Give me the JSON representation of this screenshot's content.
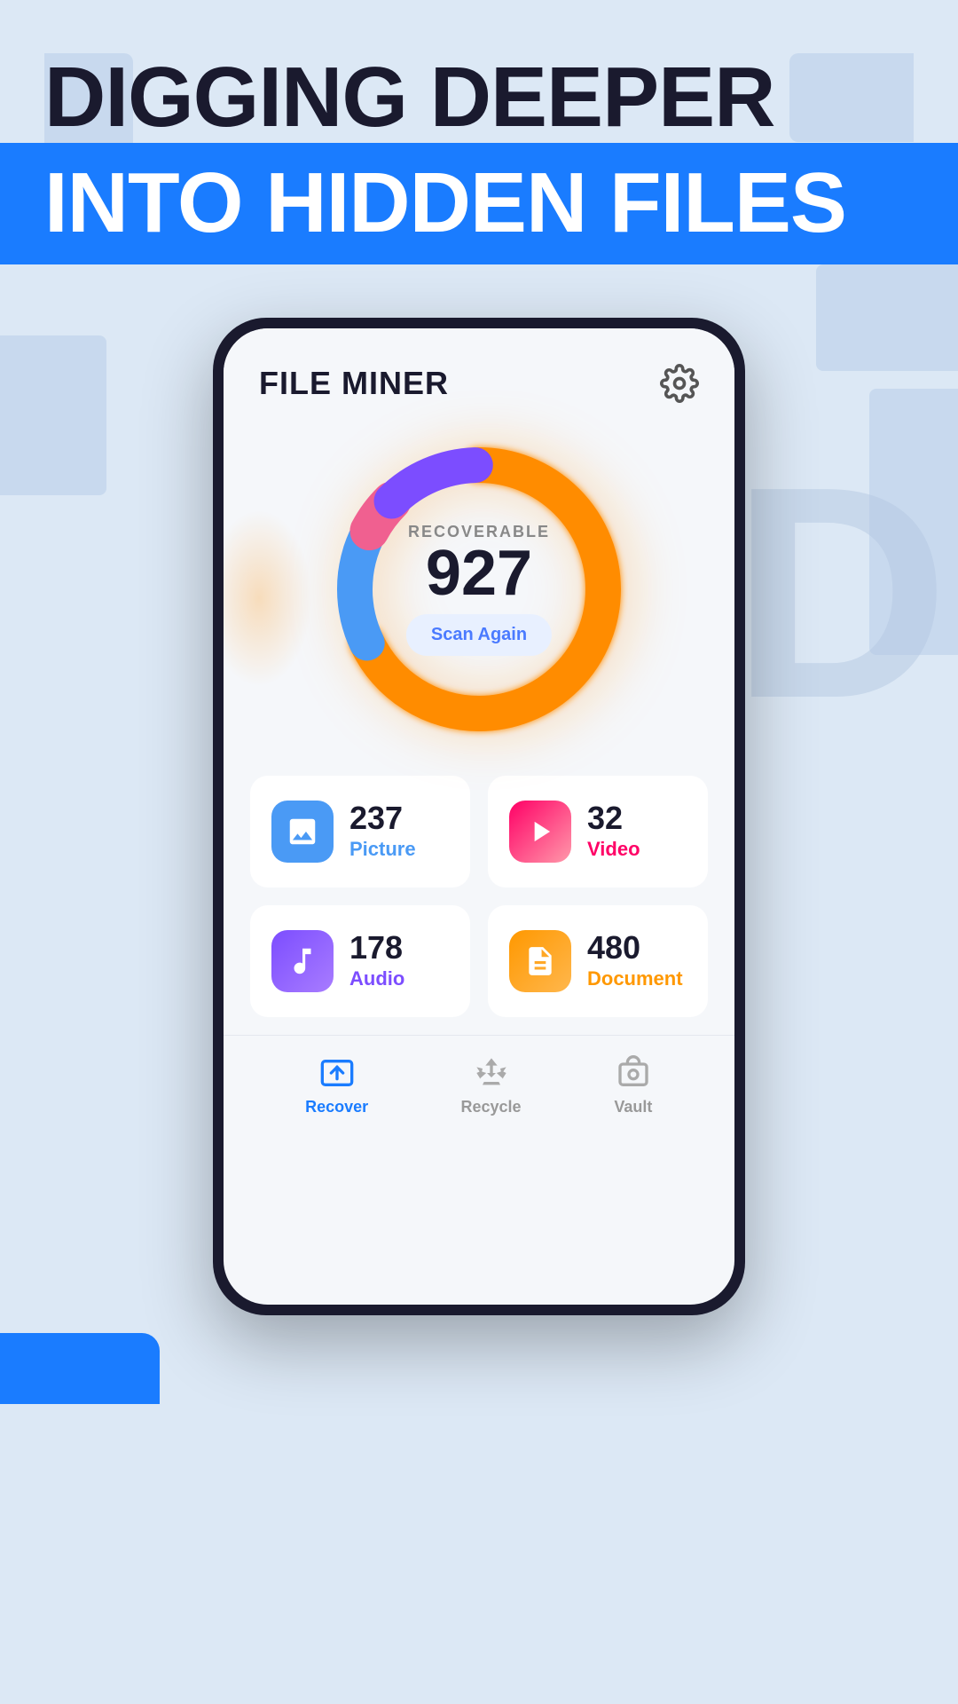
{
  "header": {
    "line1": "DIGGING DEEPER",
    "line2": "INTO HIDDEN FILES"
  },
  "app": {
    "title": "FILE MINER",
    "settings_label": "Settings"
  },
  "chart": {
    "recoverable_label": "RECOVERABLE",
    "recoverable_count": "927",
    "scan_again_label": "Scan Again",
    "segments": [
      {
        "color": "#ff8c00",
        "percent": 68,
        "label": "Orange"
      },
      {
        "color": "#4a9af5",
        "percent": 15,
        "label": "Blue"
      },
      {
        "color": "#f06090",
        "percent": 5,
        "label": "Pink"
      },
      {
        "color": "#7c4dff",
        "percent": 12,
        "label": "Purple"
      }
    ]
  },
  "file_types": [
    {
      "id": "picture",
      "count": "237",
      "label": "Picture",
      "icon": "picture"
    },
    {
      "id": "video",
      "count": "32",
      "label": "Video",
      "icon": "video"
    },
    {
      "id": "audio",
      "count": "178",
      "label": "Audio",
      "icon": "audio"
    },
    {
      "id": "document",
      "count": "480",
      "label": "Document",
      "icon": "document"
    }
  ],
  "nav": {
    "items": [
      {
        "id": "recover",
        "label": "Recover",
        "active": true
      },
      {
        "id": "recycle",
        "label": "Recycle",
        "active": false
      },
      {
        "id": "vault",
        "label": "Vault",
        "active": false
      }
    ]
  }
}
